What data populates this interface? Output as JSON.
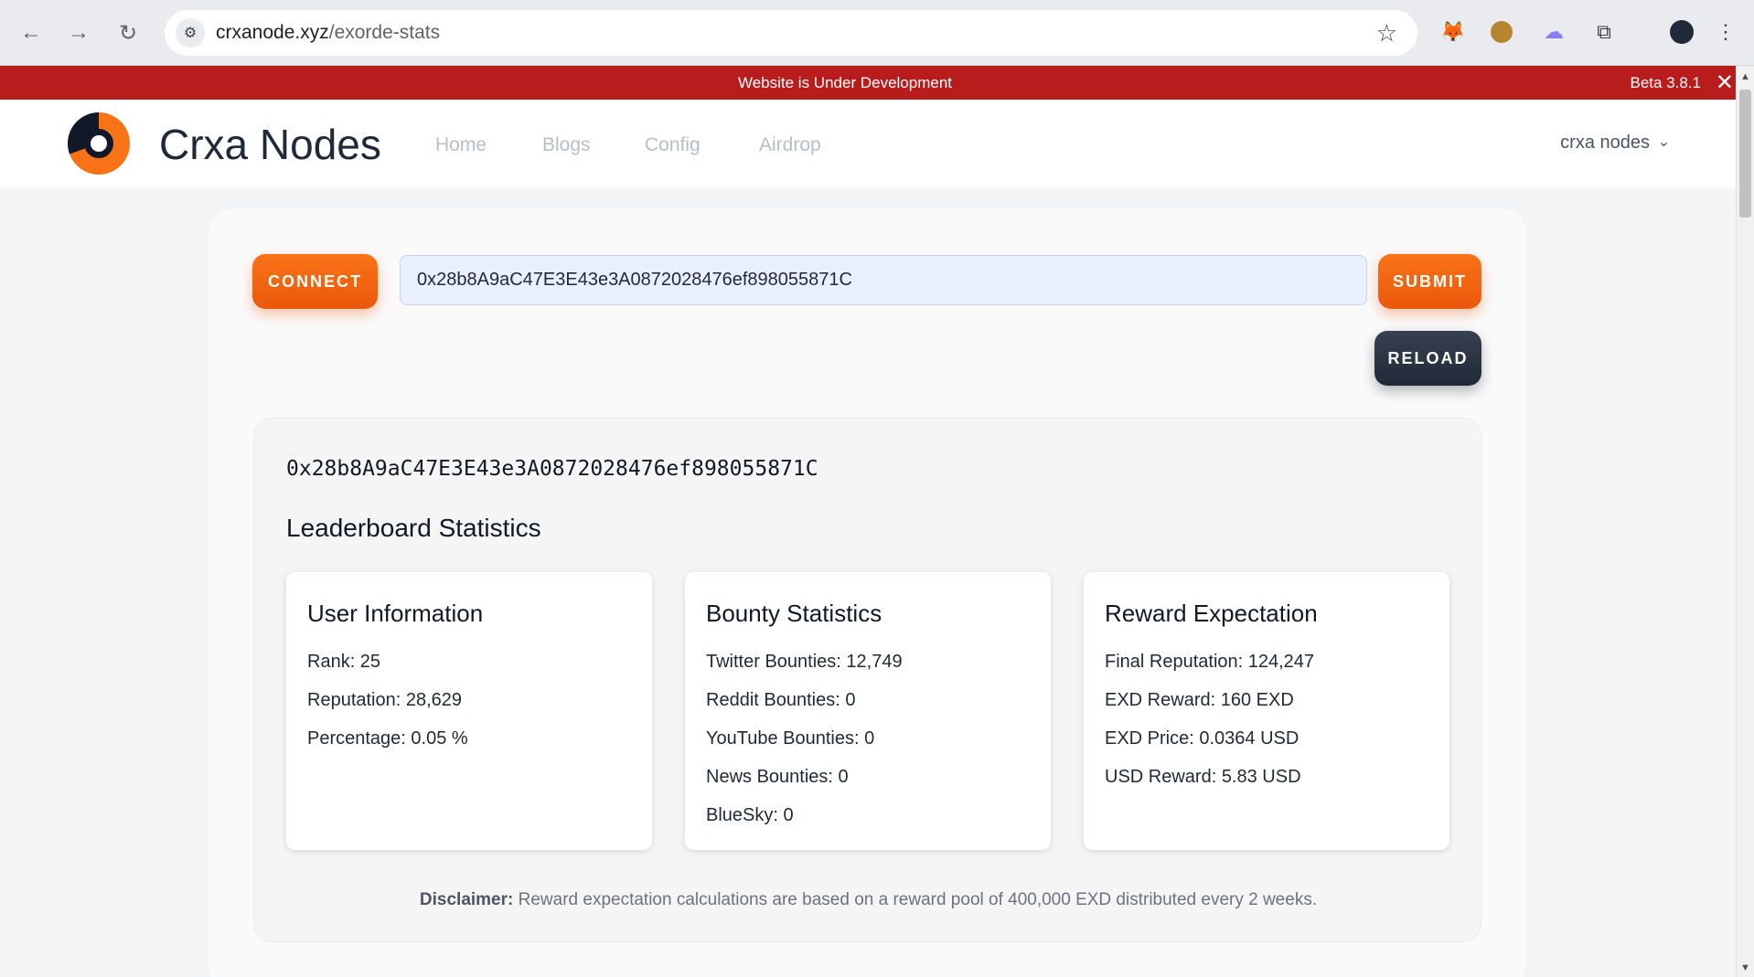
{
  "browser": {
    "url_host": "crxanode.xyz",
    "url_path": "/exorde-stats"
  },
  "banner": {
    "message": "Website is Under Development",
    "version": "Beta 3.8.1",
    "close": "✕"
  },
  "header": {
    "brand": "Crxa Nodes",
    "nav": [
      "Home",
      "Blogs",
      "Config",
      "Airdrop"
    ],
    "account": "crxa nodes"
  },
  "controls": {
    "connect_label": "CONNECT",
    "address_value": "0x28b8A9aC47E3E43e3A0872028476ef898055871C",
    "submit_label": "SUBMIT",
    "reload_label": "RELOAD"
  },
  "stats": {
    "wallet": "0x28b8A9aC47E3E43e3A0872028476ef898055871C",
    "section_title": "Leaderboard Statistics",
    "user_info": {
      "title": "User Information",
      "lines": [
        "Rank: 25",
        "Reputation: 28,629",
        "Percentage: 0.05 %"
      ]
    },
    "bounty": {
      "title": "Bounty Statistics",
      "lines": [
        "Twitter Bounties: 12,749",
        "Reddit Bounties: 0",
        "YouTube Bounties: 0",
        "News Bounties: 0",
        "BlueSky: 0"
      ]
    },
    "reward": {
      "title": "Reward Expectation",
      "lines": [
        "Final Reputation: 124,247",
        "EXD Reward: 160 EXD",
        "EXD Price: 0.0364 USD",
        "USD Reward: 5.83 USD"
      ]
    },
    "disclaimer_label": "Disclaimer:",
    "disclaimer_text": "Reward expectation calculations are based on a reward pool of 400,000 EXD distributed every 2 weeks."
  },
  "colors": {
    "accent": "#f97316",
    "banner": "#b91c1c",
    "dark_button": "#1f2937"
  }
}
